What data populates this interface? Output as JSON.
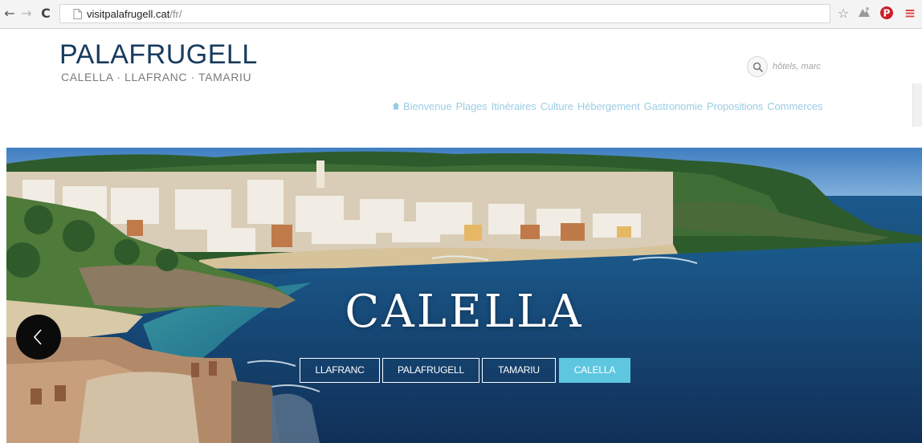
{
  "browser": {
    "url_host": "visitpalafrugell.cat",
    "url_path": "/fr/",
    "icons": [
      "back-arrow-icon",
      "forward-arrow-icon",
      "reload-icon",
      "page-icon",
      "star-icon",
      "extension-icon",
      "pinterest-icon",
      "menu-icon"
    ]
  },
  "site": {
    "logo_title": "PALAFRUGELL",
    "logo_subtitle": "CALELLA · LLAFRANC · TAMARIU",
    "search_placeholder": "hôtels, marc",
    "nav": [
      "Bienvenue",
      "Plages",
      "Itinéraires",
      "Culture",
      "Hébergement",
      "Gastronomie",
      "Propositions",
      "Commerces"
    ]
  },
  "hero": {
    "title": "CALELLA",
    "tabs": [
      {
        "label": "LLAFRANC",
        "active": false
      },
      {
        "label": "PALAFRUGELL",
        "active": false
      },
      {
        "label": "TAMARIU",
        "active": false
      },
      {
        "label": "CALELLA",
        "active": true
      }
    ]
  },
  "colors": {
    "logo": "#173b5e",
    "nav_link": "#9ccde4",
    "active_tab": "#5ec7df",
    "sea": "#1f4a78",
    "chrome_menu": "#e0463c"
  }
}
